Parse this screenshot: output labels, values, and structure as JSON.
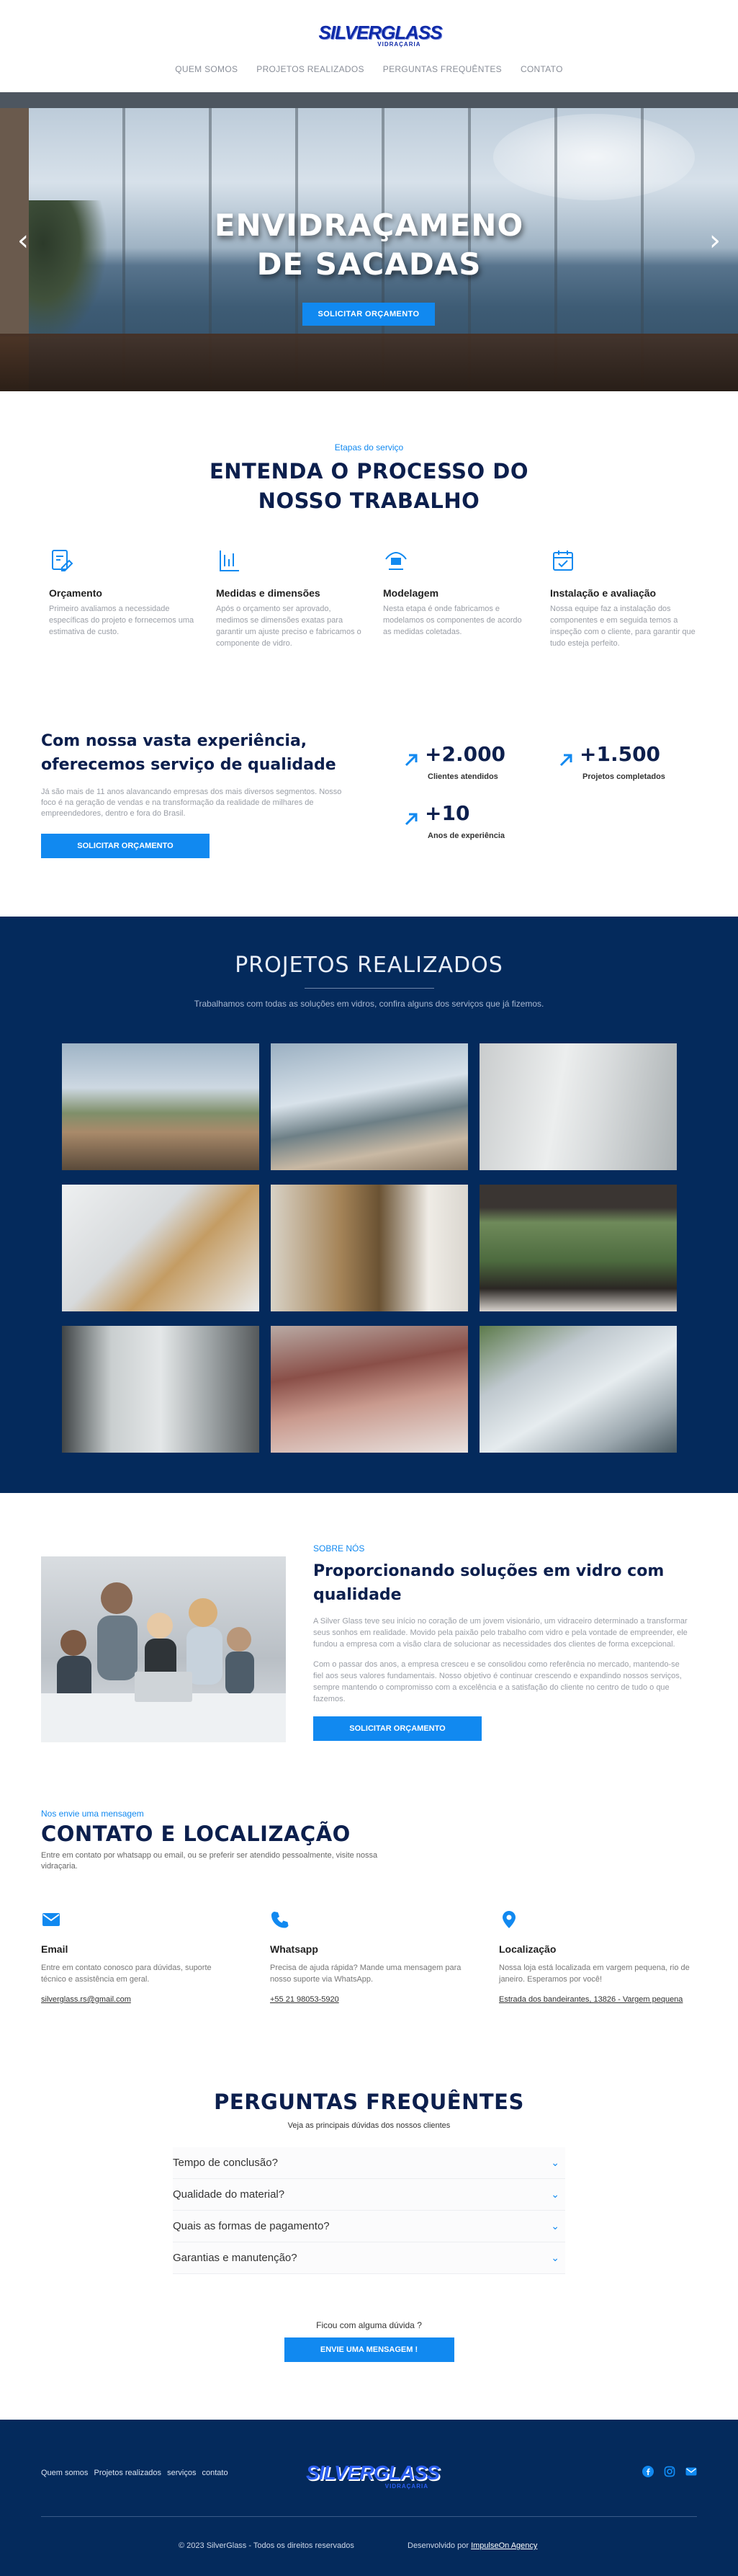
{
  "brand": {
    "logo_text": "SILVERGLASS",
    "logo_sub": "VIDRAÇARIA"
  },
  "nav": {
    "items": [
      "QUEM SOMOS",
      "PROJETOS REALIZADOS",
      "PERGUNTAS FREQUÊNTES",
      "CONTATO"
    ]
  },
  "hero": {
    "title": "ENVIDRAÇAMENO DE SACADAS",
    "cta": "SOLICITAR ORÇAMENTO"
  },
  "process": {
    "eyebrow": "Etapas do serviço",
    "title": "ENTENDA O PROCESSO DO NOSSO TRABALHO",
    "steps": [
      {
        "icon": "quote-icon",
        "title": "Orçamento",
        "text": "Primeiro avaliamos a necessidade específicas do projeto e fornecemos uma estimativa de custo."
      },
      {
        "icon": "measure-icon",
        "title": "Medidas e dimensões",
        "text": "Após o orçamento ser aprovado, medimos se dimensões exatas para garantir um ajuste preciso e fabricamos o componente de vidro."
      },
      {
        "icon": "modeling-icon",
        "title": "Modelagem",
        "text": "Nesta etapa é onde fabricamos e modelamos os componentes de acordo as medidas coletadas."
      },
      {
        "icon": "calendar-icon",
        "title": "Instalação e avaliação",
        "text": "Nossa equipe faz a instalação dos componentes e em seguida temos a inspeção com o cliente, para garantir que tudo esteja perfeito."
      }
    ]
  },
  "experience": {
    "title": "Com nossa vasta experiência, oferecemos serviço de qualidade",
    "text": "Já são mais de 11 anos alavancando empresas dos mais diversos segmentos. Nosso foco é na geração de vendas e na transformação da realidade de milhares de empreendedores, dentro e fora do Brasil.",
    "cta": "SOLICITAR ORÇAMENTO",
    "stats": [
      {
        "value": "+2.000",
        "label": "Clientes atendidos"
      },
      {
        "value": "+1.500",
        "label": "Projetos completados"
      },
      {
        "value": "+10",
        "label": "Anos de experiência"
      }
    ]
  },
  "projects": {
    "title": "PROJETOS REALIZADOS",
    "subtitle": "Trabalhamos com todas as soluções em vidros, confira alguns dos serviços que já fizemos.",
    "tiles": [
      "balcony-curved",
      "balcony-sea",
      "office-partition",
      "glass-stair",
      "shower-box",
      "window-view",
      "frosted-partition",
      "pergola-roof",
      "skylight-roof"
    ]
  },
  "about": {
    "eyebrow": "SOBRE NÓS",
    "title": "Proporcionando soluções em vidro com qualidade",
    "p1": "A Silver Glass teve seu início no coração de um jovem visionário, um vidraceiro determinado a transformar seus sonhos em realidade. Movido pela paixão pelo trabalho com vidro e pela vontade de empreender, ele fundou a empresa com a visão clara de solucionar as necessidades dos clientes de forma excepcional.",
    "p2": "Com o passar dos anos, a empresa cresceu e se consolidou como referência no mercado, mantendo-se fiel aos seus valores fundamentais. Nosso objetivo é continuar crescendo e expandindo nossos serviços, sempre mantendo o compromisso com a excelência e a satisfação do cliente no centro de tudo o que fazemos.",
    "cta": "SOLICITAR ORÇAMENTO"
  },
  "contact": {
    "eyebrow": "Nos envie uma mensagem",
    "title": "CONTATO E LOCALIZAÇÃO",
    "intro": "Entre em contato por whatsapp ou email, ou se preferir ser atendido pessoalmente, visite nossa vidraçaria.",
    "cols": [
      {
        "icon": "email-icon",
        "title": "Email",
        "text": "Entre em contato conosco para dúvidas, suporte técnico e assistência em geral.",
        "link": "silverglass.rs@gmail.com"
      },
      {
        "icon": "phone-icon",
        "title": "Whatsapp",
        "text": "Precisa de ajuda rápida? Mande uma mensagem para nosso suporte via WhatsApp.",
        "link": "+55 21 98053-5920"
      },
      {
        "icon": "location-pin-icon",
        "title": "Localização",
        "text": "Nossa loja está localizada em vargem pequena, rio de janeiro. Esperamos por você!",
        "link": "Estrada dos bandeirantes, 13826 - Vargem pequena"
      }
    ]
  },
  "faq": {
    "title": "PERGUNTAS FREQUÊNTES",
    "subtitle": "Veja as principais dúvidas dos nossos clientes",
    "items": [
      "Tempo de conclusão?",
      "Qualidade do material?",
      "Quais as formas de pagamento?",
      "Garantias e manutenção?"
    ],
    "question": "Ficou com alguma dúvida ?",
    "cta": "ENVIE UMA MENSAGEM !"
  },
  "footer": {
    "links": [
      "Quem somos",
      "Projetos realizados",
      "serviços",
      "contato"
    ],
    "copyright": "© 2023 SilverGlass - Todos os direitos reservados",
    "dev_prefix": "Desenvolvido por",
    "dev_name": "ImpulseOn Agency",
    "social": [
      "facebook-icon",
      "instagram-icon",
      "email-icon"
    ]
  },
  "colors": {
    "accent": "#1189f0",
    "navy": "#042a5c",
    "heading": "#0c1f4d"
  }
}
